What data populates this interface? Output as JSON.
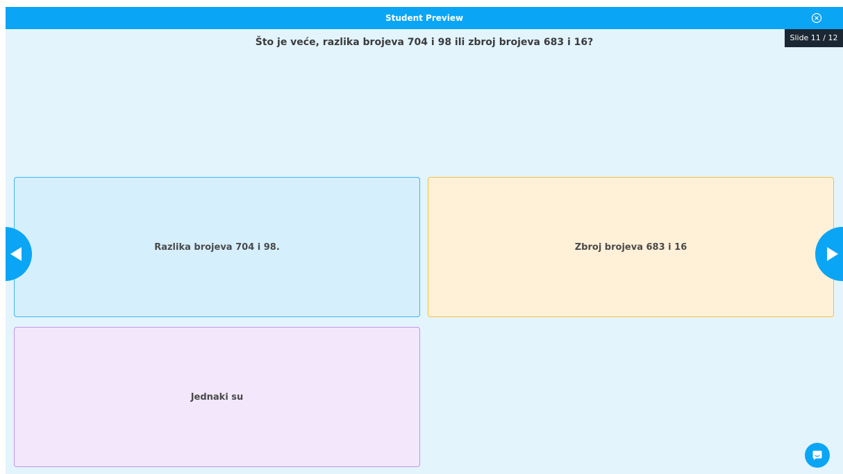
{
  "header": {
    "title": "Student Preview",
    "close_icon": "close-circle-icon",
    "bar_color": "#0ba5f5"
  },
  "slide_counter": "Slide 11 / 12",
  "question": "Što je veće, razlika brojeva 704 i 98 ili zbroj brojeva 683 i 16?",
  "options": [
    {
      "label": "Razlika brojeva 704 i 98.",
      "color": "#d6effc",
      "border": "#3db5ef"
    },
    {
      "label": "Zbroj brojeva 683 i 16",
      "color": "#fff0d8",
      "border": "#f5c141"
    },
    {
      "label": "Jednaki su",
      "color": "#f3e7fb",
      "border": "#c197e6"
    }
  ],
  "navigation": {
    "prev_icon": "triangle-left-icon",
    "next_icon": "triangle-right-icon"
  },
  "chat_icon": "chat-bubble-icon"
}
